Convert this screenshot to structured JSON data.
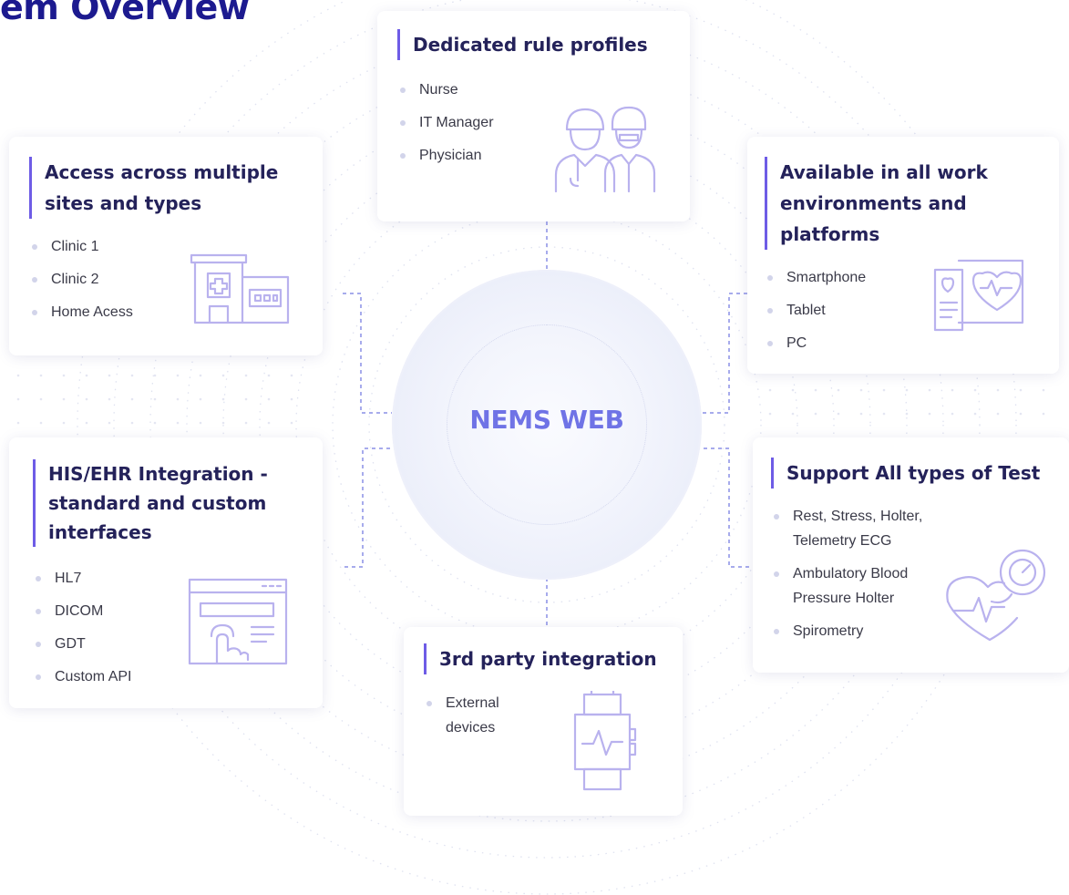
{
  "page": {
    "title": "em Overview"
  },
  "center": {
    "label": "NEMS WEB"
  },
  "cards": {
    "rule_profiles": {
      "title": "Dedicated rule profiles",
      "items": [
        "Nurse",
        "IT Manager",
        "Physician"
      ],
      "icon": "medical-staff-icon"
    },
    "access": {
      "title": "Access across multiple sites and types",
      "items": [
        "Clinic 1",
        "Clinic 2",
        "Home Acess"
      ],
      "icon": "hospital-building-icon"
    },
    "environments": {
      "title": "Available in all work environments and platforms",
      "items": [
        "Smartphone",
        "Tablet",
        "PC"
      ],
      "icon": "devices-heart-icon"
    },
    "his_ehr": {
      "title": "HIS/EHR Integration - standard and custom interfaces",
      "items": [
        "HL7",
        "DICOM",
        "GDT",
        "Custom API"
      ],
      "icon": "touch-interface-icon"
    },
    "tests": {
      "title": "Support All types of Test",
      "items": [
        "Rest, Stress, Holter, Telemetry ECG",
        "Ambulatory Blood Pressure Holter",
        "Spirometry"
      ],
      "icon": "heart-gauge-icon"
    },
    "third_party": {
      "title": "3rd party integration",
      "items": [
        "External devices"
      ],
      "icon": "smartwatch-icon"
    }
  },
  "colors": {
    "title": "#1c1a8f",
    "card_accent": "#6e5ce6",
    "center_label": "#6f73e6",
    "connector": "#8a8fe6",
    "icon_stroke": "#b9b2ee"
  }
}
